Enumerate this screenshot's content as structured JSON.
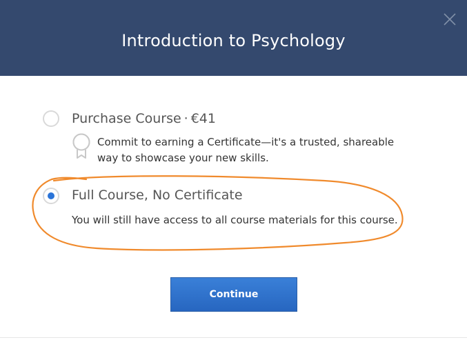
{
  "header": {
    "title": "Introduction to Psychology"
  },
  "options": [
    {
      "title": "Purchase Course",
      "separator": "·",
      "price": "€41",
      "description": "Commit to earning a Certificate—it's a trusted, shareable way to showcase your new skills.",
      "selected": false
    },
    {
      "title": "Full Course, No Certificate",
      "description": "You will still have access to all course materials for this course.",
      "selected": true
    }
  ],
  "actions": {
    "continue_label": "Continue"
  },
  "icons": {
    "close": "close-icon",
    "certificate": "certificate-icon"
  },
  "colors": {
    "header_bg": "#34496e",
    "accent_blue": "#2b74d8",
    "annotation_orange": "#f08a2c"
  }
}
